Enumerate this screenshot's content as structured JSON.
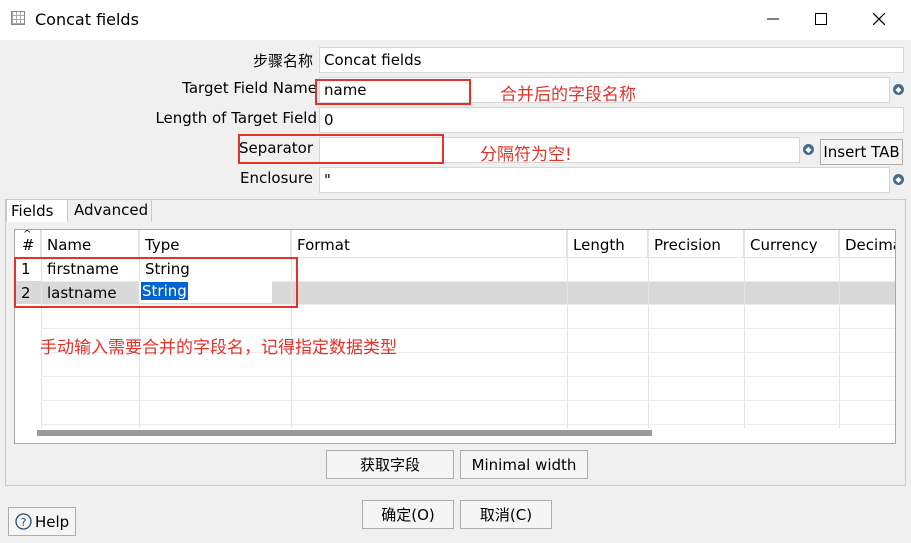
{
  "window": {
    "title": "Concat fields"
  },
  "form": {
    "step_name_label": "步骤名称",
    "step_name_value": "Concat fields",
    "target_field_label": "Target Field Name",
    "target_field_value": "name",
    "length_label": "Length of Target Field",
    "length_value": "0",
    "separator_label": "Separator",
    "separator_value": "",
    "insert_tab_label": "Insert TAB",
    "enclosure_label": "Enclosure",
    "enclosure_value": "\""
  },
  "annotations": {
    "target_note": "合并后的字段名称",
    "separator_note": "分隔符为空!",
    "fields_note": "手动输入需要合并的字段名，记得指定数据类型"
  },
  "tabs": [
    {
      "label": "Fields"
    },
    {
      "label": "Advanced"
    }
  ],
  "table": {
    "columns": [
      "#",
      "Name",
      "Type",
      "Format",
      "Length",
      "Precision",
      "Currency",
      "Decima"
    ],
    "rows": [
      {
        "num": "1",
        "name": "firstname",
        "type": "String"
      },
      {
        "num": "2",
        "name": "lastname",
        "type": "String"
      }
    ]
  },
  "buttons": {
    "get_fields": "获取字段",
    "minimal_width": "Minimal width",
    "ok": "确定(O)",
    "cancel": "取消(C)",
    "help": "Help"
  },
  "colors": {
    "annotation_red": "#e0332a",
    "selection_blue": "#0063d1"
  }
}
